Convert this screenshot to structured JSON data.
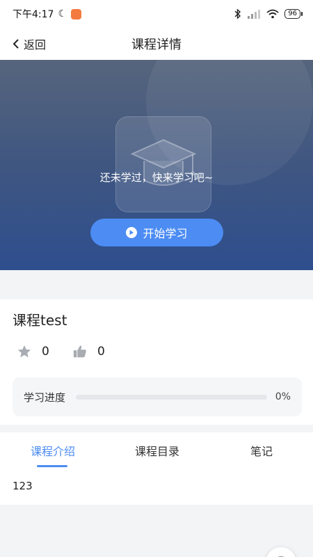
{
  "status_bar": {
    "time": "下午4:17",
    "battery": "96",
    "icons": [
      "moon-icon",
      "app-notification-icon",
      "bluetooth-icon",
      "signal-icon",
      "wifi-icon",
      "battery-icon"
    ]
  },
  "nav": {
    "back_label": "返回",
    "title": "课程详情"
  },
  "hero": {
    "message": "还未学过，快来学习吧~",
    "start_button": "开始学习",
    "placeholder_icon": "graduation-cap-icon"
  },
  "course": {
    "title": "课程test",
    "favorites": "0",
    "likes": "0",
    "progress_label": "学习进度",
    "progress_value": "0%",
    "progress_fraction": 0
  },
  "tabs": {
    "items": [
      {
        "label": "课程介绍",
        "active": true
      },
      {
        "label": "课程目录",
        "active": false
      },
      {
        "label": "笔记",
        "active": false
      }
    ],
    "content": "123"
  },
  "colors": {
    "accent": "#4c8cf3",
    "hero_top": "#56657d",
    "hero_bottom": "#2e4e8e",
    "background": "#f3f4f6"
  }
}
